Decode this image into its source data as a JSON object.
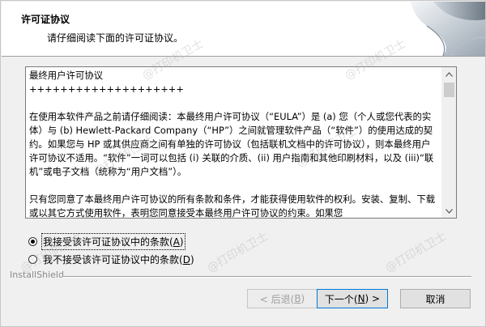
{
  "header": {
    "title": "许可证协议",
    "subtitle": "请仔细阅读下面的许可证协议。"
  },
  "license": {
    "paragraphs": [
      "最终用户许可协议",
      "++++++++++++++++++++",
      "",
      "在使用本软件产品之前请仔细阅读：本最终用户许可协议（“EULA”）是 (a) 您（个人或您代表的实体）与 (b) Hewlett-Packard Company（“HP”）之间就管理软件产品（“软件”）的使用达成的契约。如果您与 HP 或其供应商之间有单独的许可协议（包括联机文档中的许可协议），则本最终用户许可协议不适用。“软件”一词可以包括 (i) 关联的介质、(ii) 用户指南和其他印刷材料，以及 (iii)“联机”或电子文档（统称为“用户文档”）。",
      "",
      "只有您同意了本最终用户许可协议的所有条款和条件，才能获得使用软件的权利。安装、复制、下载或以其它方式使用软件，表明您同意接受本最终用户许可协议的约束。如果您"
    ]
  },
  "options": {
    "accept_label": "我接受该许可证协议中的条款(",
    "accept_key": "A",
    "accept_close": ")",
    "decline_label": "我不接受该许可证协议中的条款(",
    "decline_key": "D",
    "decline_close": ")",
    "selected": "accept"
  },
  "footer": {
    "brand": "InstallShield"
  },
  "buttons": {
    "back_prefix": "< 后退(",
    "back_key": "B",
    "back_suffix": ")",
    "next_prefix": "下一个(",
    "next_key": "N",
    "next_suffix": ") >",
    "cancel": "取消"
  },
  "watermark": {
    "text": "@打印机卫士"
  },
  "colors": {
    "focus_border": "#0078d7",
    "disabled_text": "#a0a0a0"
  }
}
